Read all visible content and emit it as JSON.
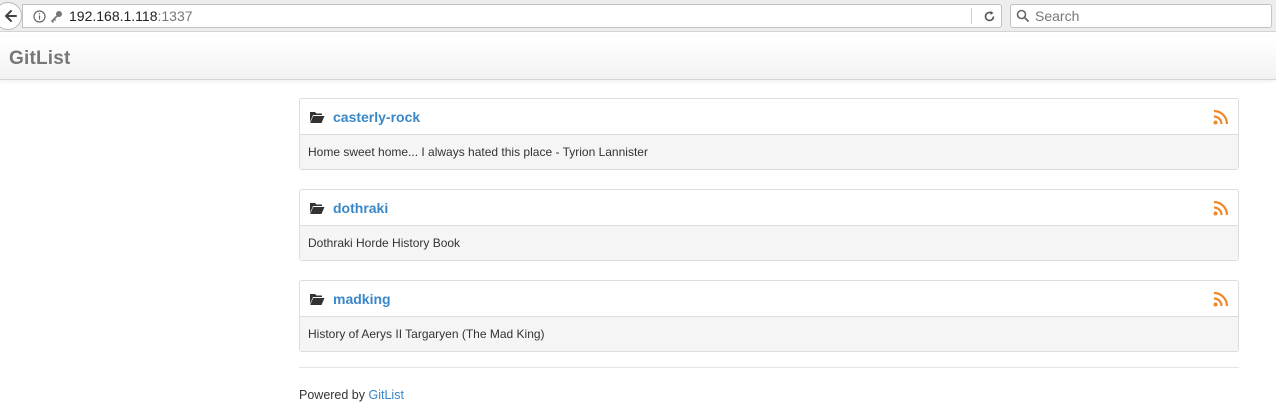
{
  "browser": {
    "url_host": "192.168.1.118",
    "url_port": ":1337",
    "search_placeholder": "Search"
  },
  "app": {
    "brand": "GitList"
  },
  "repositories": [
    {
      "name": "casterly-rock",
      "description": "Home sweet home... I always hated this place - Tyrion Lannister"
    },
    {
      "name": "dothraki",
      "description": "Dothraki Horde History Book"
    },
    {
      "name": "madking",
      "description": "History of Aerys II Targaryen (The Mad King)"
    }
  ],
  "footer": {
    "prefix": "Powered by",
    "link": "GitList"
  },
  "colors": {
    "link": "#3a87c8",
    "rss": "#f0882a"
  },
  "icons": {
    "back": "back-arrow-icon",
    "info": "info-icon",
    "key": "key-icon",
    "reload": "reload-icon",
    "search": "search-icon",
    "folder": "folder-open-icon",
    "rss": "rss-icon"
  }
}
